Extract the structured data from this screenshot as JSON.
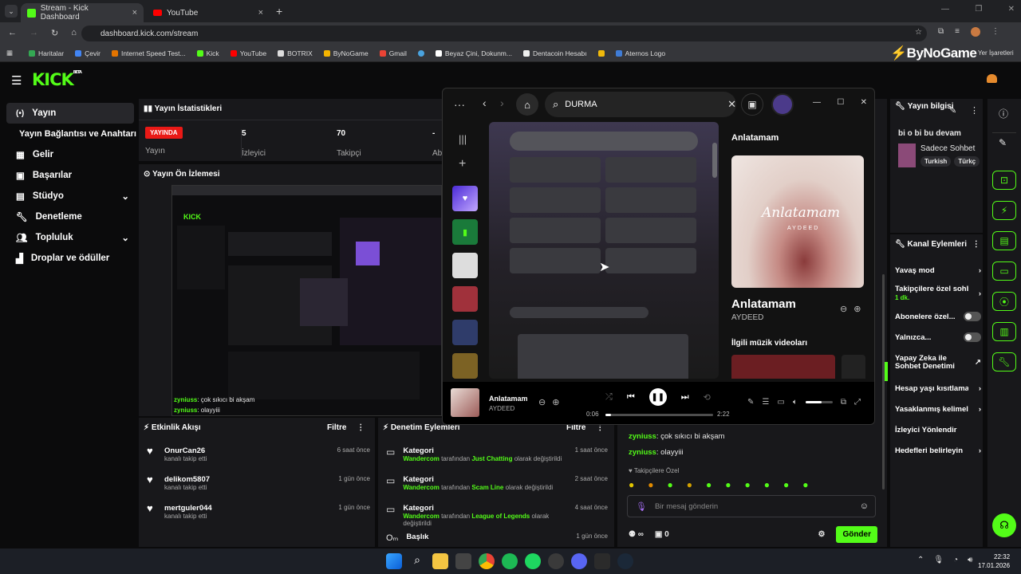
{
  "browser": {
    "tabs": [
      {
        "title": "Stream - Kick Dashboard"
      },
      {
        "title": "YouTube"
      }
    ],
    "url": "dashboard.kick.com/stream",
    "bookmarks": [
      "Haritalar",
      "Çevir",
      "Internet Speed Test...",
      "Kick",
      "YouTube",
      "BOTRIX",
      "ByNoGame",
      "Gmail",
      "",
      "Beyaz Çini, Dokunm...",
      "Dentacoin Hesabı",
      "",
      "Aternos Logo"
    ],
    "watermark": "ByNoGame",
    "other_bookmarks": "Yer İşaretleri"
  },
  "kick": {
    "logo": "KICK",
    "beta": "BETA",
    "nav": [
      {
        "label": "Yayın",
        "icon": "broadcast-icon"
      },
      {
        "label": "Yayın Bağlantısı ve Anahtarı",
        "icon": ""
      },
      {
        "label": "Gelir",
        "icon": "money-icon"
      },
      {
        "label": "Başarılar",
        "icon": "trophy-icon"
      },
      {
        "label": "Stüdyo",
        "icon": "studio-icon",
        "chevron": true
      },
      {
        "label": "Denetleme",
        "icon": "wrench-icon"
      },
      {
        "label": "Topluluk",
        "icon": "people-icon",
        "chevron": true
      },
      {
        "label": "Droplar ve ödüller",
        "icon": "gift-icon"
      }
    ],
    "stats": {
      "title": "Yayın İstatistikleri",
      "live_badge": "YAYINDA",
      "stream_label": "Yayın",
      "viewers": "5",
      "viewers_label": "İzleyici",
      "followers": "70",
      "followers_label": "Takipçi",
      "extra": "-",
      "extra_label": "Ab"
    },
    "preview_title": "Yayın Ön İzlemesi",
    "preview_chat": [
      {
        "user": "zyniuss",
        "text": "çok sıkıcı bi akşam"
      },
      {
        "user": "zyniuss",
        "text": "olayyiii"
      }
    ],
    "activity": {
      "title": "Etkinlik Akışı",
      "filter": "Filtre",
      "items": [
        {
          "user": "OnurCan26",
          "desc": "kanalı takip etti",
          "time": "6 saat önce"
        },
        {
          "user": "delikom5807",
          "desc": "kanalı takip etti",
          "time": "1 gün önce"
        },
        {
          "user": "mertguler044",
          "desc": "kanalı takip etti",
          "time": "1 gün önce"
        }
      ]
    },
    "mod_actions": {
      "title": "Denetim Eylemleri",
      "filter": "Filtre",
      "items": [
        {
          "title": "Kategori",
          "actor": "Wandercom",
          "mid": "tarafından",
          "target": "Just Chatting",
          "end": "olarak değiştirildi",
          "time": "1 saat önce"
        },
        {
          "title": "Kategori",
          "actor": "Wandercom",
          "mid": "tarafından",
          "target": "Scam Line",
          "end": "olarak değiştirildi",
          "time": "2 saat önce"
        },
        {
          "title": "Kategori",
          "actor": "Wandercom",
          "mid": "tarafından",
          "target": "League of Legends",
          "end": "olarak değiştirildi",
          "time": "4 saat önce"
        },
        {
          "title": "Başlık",
          "actor": "",
          "mid": "",
          "target": "",
          "end": "",
          "time": "1 gün önce"
        }
      ]
    },
    "chat": {
      "messages": [
        {
          "user": "zyniuss",
          "text": "çok sıkıcı bi akşam"
        },
        {
          "user": "zyniuss",
          "text": "olayyiii"
        }
      ],
      "follower_only": "Takipçilere Özel",
      "placeholder": "Bir mesaj gönderin",
      "points": "0",
      "send": "Gönder"
    },
    "stream_info": {
      "title": "Yayın bilgisi",
      "stream_title": "bi o bi bu devam",
      "category": "Sadece Sohbet",
      "tags": [
        "Turkish",
        "Türkç"
      ]
    },
    "channel_actions": {
      "title": "Kanal Eylemleri",
      "items": [
        {
          "label": "Yavaş mod",
          "type": "chevron"
        },
        {
          "label": "Takipçilere özel sohb",
          "sub": "1 dk.",
          "type": "chevron"
        },
        {
          "label": "Abonelere özel...",
          "type": "toggle"
        },
        {
          "label": "Yalnızca...",
          "type": "toggle"
        },
        {
          "label": "Yapay Zeka ile Sohbet Denetimi",
          "type": "link"
        },
        {
          "label": "Hesap yaşı kısıtlama",
          "type": "chevron"
        },
        {
          "label": "Yasaklanmış kelimel",
          "type": "chevron"
        },
        {
          "label": "İzleyici Yönlendir",
          "type": "none"
        },
        {
          "label": "Hedefleri belirleyin",
          "type": "chevron"
        }
      ]
    }
  },
  "spotify": {
    "search": "DURMA",
    "now_playing_title": "Anlatamam",
    "np_heading": "Anlatamam",
    "art_title": "Anlatamam",
    "art_artist": "AYDEED",
    "track": "Anlatamam",
    "artist": "AYDEED",
    "related": "İlgili müzik videoları",
    "elapsed": "0:06",
    "duration": "2:22",
    "progress": 0.05,
    "volume": 0.6
  },
  "taskbar": {
    "time": "22:32",
    "date": "17.01.2026"
  },
  "colors": {
    "kick_green": "#53fc18",
    "live_red": "#e91916",
    "bg": "#0b0b0c",
    "panel": "#18181b"
  }
}
